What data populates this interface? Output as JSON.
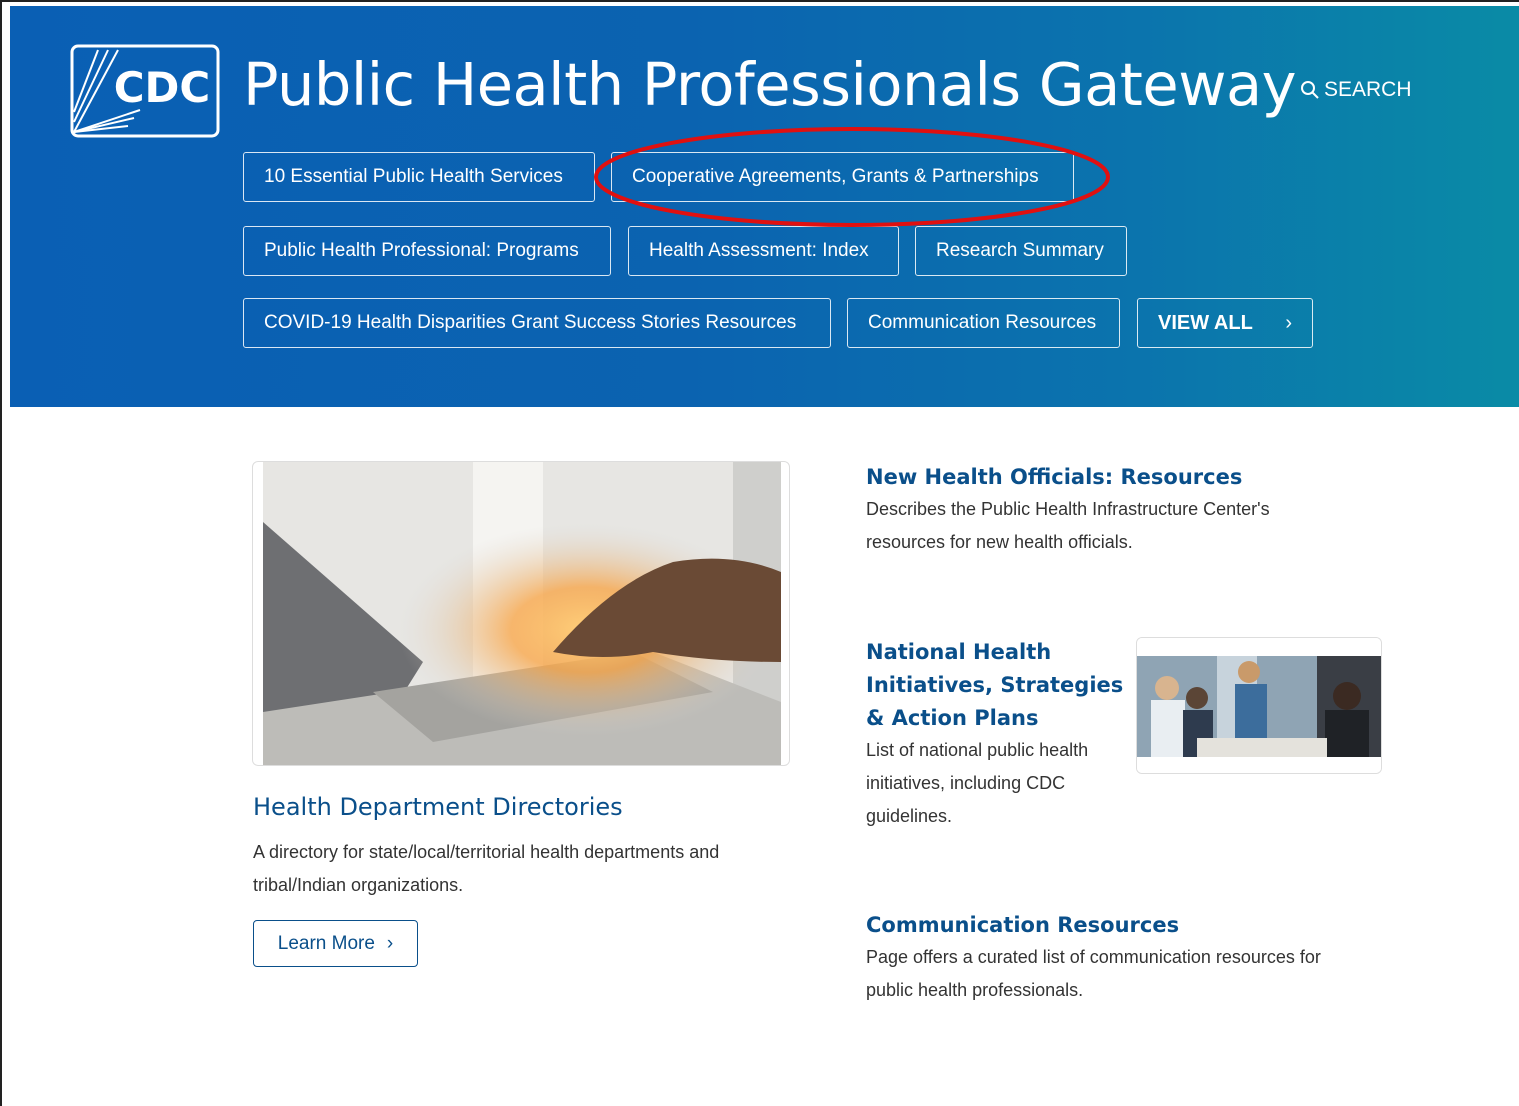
{
  "header": {
    "logo_text": "CDC",
    "title": "Public Health Professionals Gateway",
    "search_label": "SEARCH"
  },
  "nav": {
    "buttons": [
      {
        "label": "10 Essential Public Health Services"
      },
      {
        "label": "Cooperative Agreements, Grants & Partnerships"
      },
      {
        "label": "Public Health Professional: Programs"
      },
      {
        "label": "Health Assessment: Index"
      },
      {
        "label": "Research Summary"
      },
      {
        "label": "COVID-19 Health Disparities Grant Success Stories Resources"
      },
      {
        "label": "Communication Resources"
      }
    ],
    "view_all": "VIEW ALL"
  },
  "featured": {
    "title": "Health Department Directories",
    "description_line1": "A directory for state/local/territorial health departments and",
    "description_line2": "tribal/Indian organizations.",
    "button": "Learn More"
  },
  "items": [
    {
      "title": "New Health Officials: Resources",
      "line1": "Describes the Public Health Infrastructure Center's",
      "line2": "resources for new health officials."
    },
    {
      "title_line1": "National Health",
      "title_line2": "Initiatives, Strategies",
      "title_line3": "& Action Plans",
      "line1": "List of national public health",
      "line2": "initiatives, including CDC",
      "line3": "guidelines."
    },
    {
      "title": "Communication Resources",
      "line1": "Page offers a curated list of communication resources for",
      "line2": "public health professionals."
    }
  ],
  "colors": {
    "hero_start": "#0a5fb4",
    "hero_end": "#0a8ba6",
    "link": "#0a4f8a",
    "annotation": "#e01010"
  },
  "icons": [
    "cdc-logo",
    "search-icon",
    "chevron-right-icon"
  ]
}
